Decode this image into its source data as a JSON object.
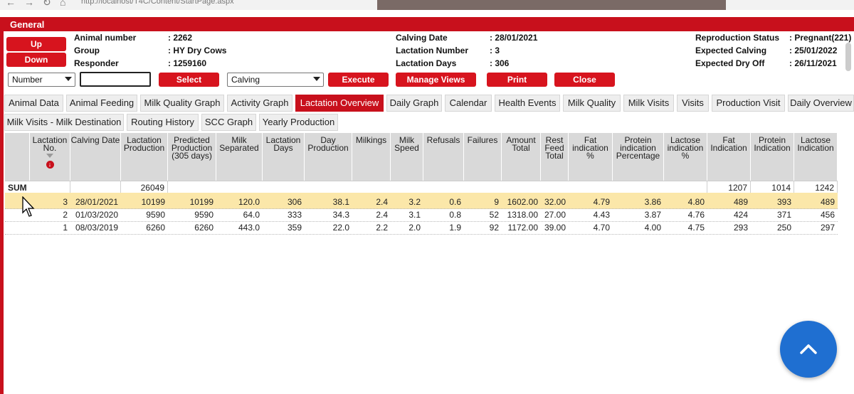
{
  "browser": {
    "url": "http://localhost/T4C/Content/StartPage.aspx"
  },
  "panel_title": "General",
  "buttons": {
    "up": "Up",
    "down": "Down",
    "select": "Select",
    "execute": "Execute",
    "manage_views": "Manage Views",
    "print": "Print",
    "close": "Close"
  },
  "animal": {
    "labels": {
      "animal_number": "Animal number",
      "group": "Group",
      "responder": "Responder"
    },
    "values": {
      "animal_number": ": 2262",
      "group": ": HY Dry Cows",
      "responder": ": 1259160"
    }
  },
  "lactation": {
    "labels": {
      "calving_date": "Calving Date",
      "lactation_number": "Lactation Number",
      "lactation_days": "Lactation Days"
    },
    "values": {
      "calving_date": ": 28/01/2021",
      "lactation_number": ": 3",
      "lactation_days": ": 306"
    }
  },
  "reproduction": {
    "labels": {
      "status": "Reproduction Status",
      "expected_calving": "Expected Calving",
      "expected_dry_off": "Expected Dry Off"
    },
    "values": {
      "status": ": Pregnant(221)",
      "expected_calving": ": 25/01/2022",
      "expected_dry_off": ": 26/11/2021"
    }
  },
  "search": {
    "field_select": "Number",
    "input_value": "",
    "view_select": "Calving"
  },
  "tabs_row1": [
    "Animal Data",
    "Animal Feeding",
    "Milk Quality Graph",
    "Activity Graph",
    "Lactation Overview",
    "Daily Graph",
    "Calendar",
    "Health Events",
    "Milk Quality",
    "Milk Visits",
    "Visits",
    "Production Visit",
    "Daily Overview"
  ],
  "tabs_row2": [
    "Milk Visits - Milk Destination",
    "Routing History",
    "SCC Graph",
    "Yearly Production"
  ],
  "active_tab": "Lactation Overview",
  "table": {
    "headers": [
      "Lactation No.",
      "Calving Date",
      "Lactation Production",
      "Predicted Production (305 days)",
      "Milk Separated",
      "Lactation Days",
      "Day Production",
      "Milkings",
      "Milk Speed",
      "Refusals",
      "Failures",
      "Amount Total",
      "Rest Feed Total",
      "Fat indication %",
      "Protein indication Percentage",
      "Lactose indication %",
      "Fat Indication",
      "Protein Indication",
      "Lactose Indication"
    ],
    "sum_label": "SUM",
    "sum": {
      "lactation_production": "26049",
      "fat_indication": "1207",
      "protein_indication": "1014",
      "lactose_indication": "1242"
    },
    "rows": [
      [
        "3",
        "28/01/2021",
        "10199",
        "10199",
        "120.0",
        "306",
        "38.1",
        "2.4",
        "3.2",
        "0.6",
        "9",
        "1602.00",
        "32.00",
        "4.79",
        "3.86",
        "4.80",
        "489",
        "393",
        "489"
      ],
      [
        "2",
        "01/03/2020",
        "9590",
        "9590",
        "64.0",
        "333",
        "34.3",
        "2.4",
        "3.1",
        "0.8",
        "52",
        "1318.00",
        "27.00",
        "4.43",
        "3.87",
        "4.76",
        "424",
        "371",
        "456"
      ],
      [
        "1",
        "08/03/2019",
        "6260",
        "6260",
        "443.0",
        "359",
        "22.0",
        "2.2",
        "2.0",
        "1.9",
        "92",
        "1172.00",
        "39.00",
        "4.70",
        "4.00",
        "4.75",
        "293",
        "250",
        "297"
      ]
    ]
  },
  "colors": {
    "brand_red": "#c8101c",
    "button_red": "#d7141e",
    "selected_row": "#fbe7a9",
    "fab_blue": "#1f6fd1"
  },
  "icons": {
    "sort": "sort-triangle-icon",
    "lock": "lock-icon",
    "fab": "chevron-up-icon"
  }
}
